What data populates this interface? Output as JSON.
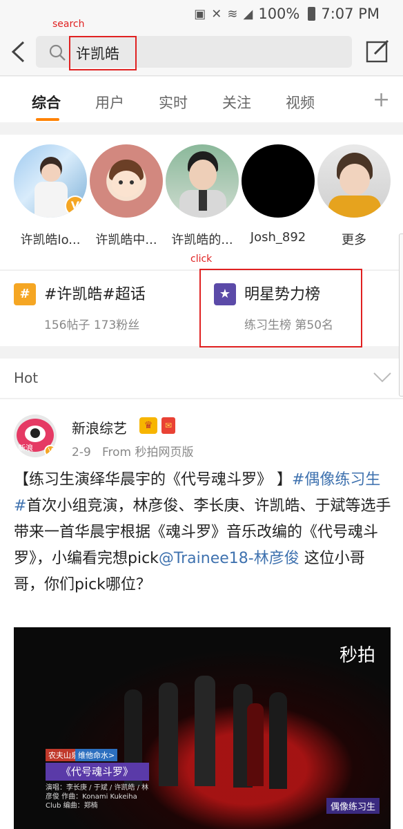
{
  "status_bar": {
    "battery": "100%",
    "time": "7:07 PM"
  },
  "search": {
    "query": "许凯皓",
    "annotation": "search"
  },
  "tabs": [
    {
      "label": "综合",
      "active": true
    },
    {
      "label": "用户",
      "active": false
    },
    {
      "label": "实时",
      "active": false
    },
    {
      "label": "关注",
      "active": false
    },
    {
      "label": "视频",
      "active": false
    }
  ],
  "tab_plus": "+",
  "users": [
    {
      "label": "许凯皓lo...",
      "verified": true
    },
    {
      "label": "许凯皓中..."
    },
    {
      "label": "许凯皓的..."
    },
    {
      "label": "Josh_892"
    },
    {
      "label": "更多"
    }
  ],
  "topics": {
    "left": {
      "title": "#许凯皓#超话",
      "sub": "156帖子  173粉丝",
      "icon": "#"
    },
    "right": {
      "title": "明星势力榜",
      "sub": "练习生榜 第50名",
      "icon": "★"
    },
    "annotation": "click"
  },
  "hot": {
    "title": "Hot"
  },
  "post": {
    "author": "新浪综艺",
    "avatar_text": "新浪",
    "date": "2-9",
    "source": "From 秒拍网页版",
    "body_parts": [
      {
        "text": "【练习生演绎华晨宇的《代号魂斗罗》 】",
        "link": false
      },
      {
        "text": "#偶像练习生#",
        "link": true
      },
      {
        "text": "首次小组竞演，林彦俊、李长庚、许凯皓、于斌等选手带来一首华晨宇根据《魂斗罗》音乐改编的《代号魂斗罗》，小编看完想pick",
        "link": false
      },
      {
        "text": "@Trainee18-林彦俊",
        "link": true
      },
      {
        "text": " 这位小哥哥，你们pick哪位？",
        "link": false
      }
    ],
    "video": {
      "logo": "秒拍",
      "tag1": "农夫山泉",
      "tag2": "维他命水>",
      "caption": "《代号魂斗罗》",
      "credits": "演唱：李长庚 / 于斌 / 许凯皓 / 林彦俊 作曲：Konami Kukeiha Club 编曲：郑楠",
      "brand": "偶像练习生"
    }
  },
  "colors": {
    "accent": "#ff8200",
    "link": "#3f72af",
    "annotation": "#e02020"
  }
}
